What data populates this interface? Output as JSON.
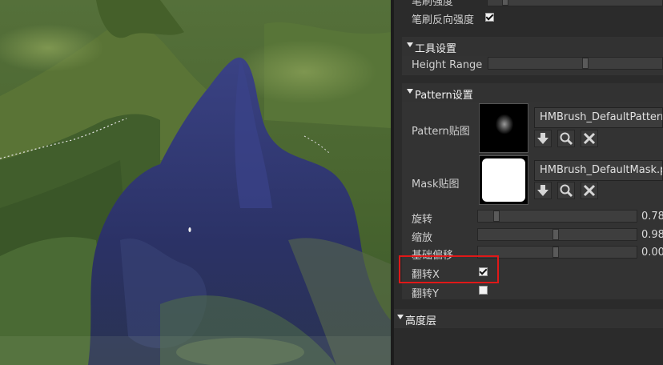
{
  "panel": {
    "top_partial_label": "笔刷强度",
    "invert_strength": {
      "label": "笔刷反向强度",
      "checked": true
    },
    "tool_section": {
      "title": "工具设置"
    },
    "height_range": {
      "label": "Height Range",
      "value_fraction": 0.56
    },
    "pattern_section": {
      "title": "Pattern设置"
    },
    "pattern_texture": {
      "label": "Pattern贴图",
      "file": "HMBrush_DefaultPattern.png",
      "icons": [
        "download-icon",
        "magnifier-icon",
        "close-icon"
      ]
    },
    "mask_texture": {
      "label": "Mask贴图",
      "file": "HMBrush_DefaultMask.png",
      "icons": [
        "download-icon",
        "magnifier-icon",
        "close-icon"
      ]
    },
    "rotation": {
      "label": "旋转",
      "value": "0.78",
      "value_fraction": 0.1
    },
    "scale": {
      "label": "缩放",
      "value": "0.98",
      "value_fraction": 0.49
    },
    "base_offset": {
      "label": "基础偏移",
      "value": "0.00",
      "value_fraction": 0.49
    },
    "flip_x": {
      "label": "翻转X",
      "checked": true
    },
    "flip_y": {
      "label": "翻转Y",
      "checked": false
    },
    "height_layer_section": {
      "title": "高度层"
    }
  },
  "colors": {
    "panel_bg": "#2b2b2b",
    "highlight": "#e01818",
    "terrain_green": "#4f6a2c",
    "mountain_blue": "#2e3566"
  }
}
